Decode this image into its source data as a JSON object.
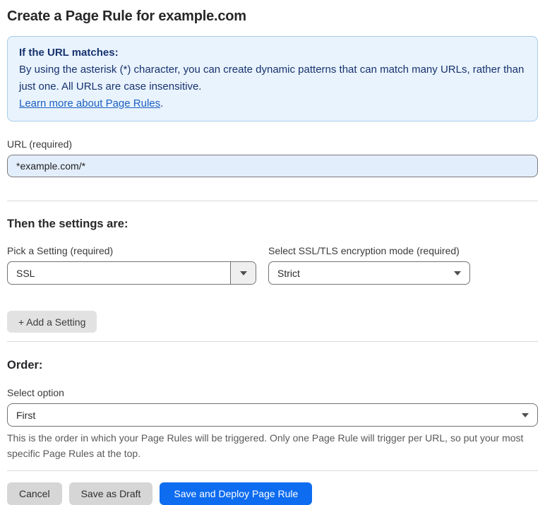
{
  "page": {
    "title": "Create a Page Rule for example.com"
  },
  "info_box": {
    "heading": "If the URL matches:",
    "body": "By using the asterisk (*) character, you can create dynamic patterns that can match many URLs, rather than just one. All URLs are case insensitive.",
    "link_label": "Learn more about Page Rules",
    "link_suffix": "."
  },
  "url_field": {
    "label": "URL (required)",
    "value": "*example.com/*"
  },
  "settings_section": {
    "heading": "Then the settings are:",
    "setting_picker": {
      "label": "Pick a Setting (required)",
      "value": "SSL"
    },
    "mode_picker": {
      "label": "Select SSL/TLS encryption mode (required)",
      "value": "Strict"
    },
    "add_setting_label": "+ Add a Setting"
  },
  "order_section": {
    "heading": "Order:",
    "select_label": "Select option",
    "value": "First",
    "help_text": "This is the order in which your Page Rules will be triggered. Only one Page Rule will trigger per URL, so put your most specific Page Rules at the top."
  },
  "footer": {
    "cancel_label": "Cancel",
    "save_draft_label": "Save as Draft",
    "save_deploy_label": "Save and Deploy Page Rule"
  },
  "icons": {
    "select_caret": "chevron-down-icon"
  },
  "colors": {
    "accent_blue": "#0d6cf0",
    "info_background": "#e9f3fd",
    "info_border": "#a9cdea",
    "info_text": "#17326e",
    "link_blue": "#1b5fc1",
    "url_input_background": "#e3eefc",
    "button_gray": "#d6d6d6",
    "divider_gray": "#d9d9d9"
  }
}
